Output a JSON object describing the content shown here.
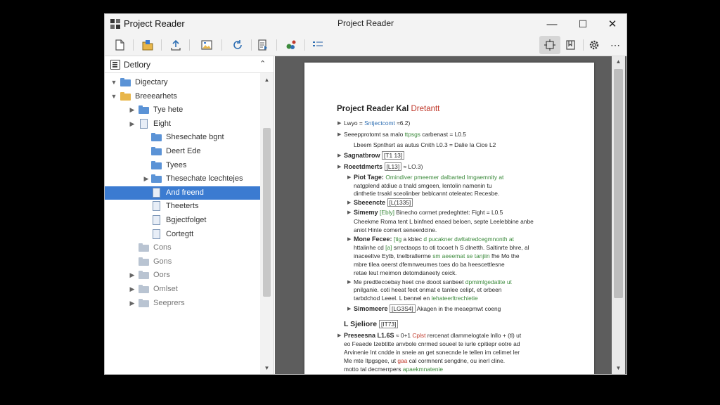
{
  "window": {
    "app_name": "Project Reader",
    "title": "Project Reader",
    "controls": {
      "minimize": "—",
      "maximize": "☐",
      "close": "✕"
    }
  },
  "toolbar": {
    "buttons": [
      {
        "icon": "new-page-icon"
      },
      {
        "icon": "open-folder-icon"
      },
      {
        "icon": "upload-icon"
      },
      {
        "icon": "image-icon"
      },
      {
        "icon": "refresh-icon"
      },
      {
        "icon": "export-icon"
      },
      {
        "icon": "color-palette-icon"
      },
      {
        "icon": "list-view-icon"
      }
    ],
    "right_buttons": [
      {
        "icon": "fit-page-icon",
        "active": true
      },
      {
        "icon": "bookmark-icon"
      },
      {
        "icon": "settings-gear-icon"
      },
      {
        "icon": "more-options-icon",
        "label": "⋯"
      }
    ]
  },
  "sidebar": {
    "header": {
      "label": "Detlory",
      "chevron": "⌃"
    },
    "tree": [
      {
        "label": "Digectary",
        "twisty": "▼",
        "icon": "folder-blue",
        "level": 0
      },
      {
        "label": "Breeearhets",
        "twisty": "▼",
        "icon": "folder-yellow",
        "level": 0
      },
      {
        "label": "Tye hete",
        "twisty": "▶",
        "icon": "folder-blue",
        "level": 1
      },
      {
        "label": "Eight",
        "twisty": "▶",
        "icon": "doc",
        "level": 1
      },
      {
        "label": "Shesechate bgnt",
        "twisty": "",
        "icon": "folder-blue",
        "level": 2
      },
      {
        "label": "Deert Ede",
        "twisty": "",
        "icon": "folder-blue",
        "level": 2
      },
      {
        "label": "Tyees",
        "twisty": "",
        "icon": "folder-blue",
        "level": 2
      },
      {
        "label": "Thesechate lcechtejes",
        "twisty": "▶",
        "icon": "folder-blue",
        "level": 2
      },
      {
        "label": "And freend",
        "twisty": "",
        "icon": "doc",
        "level": 2,
        "selected": true
      },
      {
        "label": "Theeterts",
        "twisty": "",
        "icon": "doc",
        "level": 2
      },
      {
        "label": "Bgjectfolget",
        "twisty": "",
        "icon": "doc",
        "level": 2
      },
      {
        "label": "Cortegtt",
        "twisty": "",
        "icon": "doc",
        "level": 2
      },
      {
        "label": "Cons",
        "twisty": "",
        "icon": "folder-grey",
        "level": 1,
        "muted": true
      },
      {
        "label": "Gons",
        "twisty": "",
        "icon": "folder-grey",
        "level": 1,
        "muted": true
      },
      {
        "label": "Oors",
        "twisty": "▶",
        "icon": "folder-grey",
        "level": 1,
        "muted": true
      },
      {
        "label": "Omlset",
        "twisty": "▶",
        "icon": "folder-grey",
        "level": 1,
        "muted": true
      },
      {
        "label": "Seeprers",
        "twisty": "▶",
        "icon": "folder-grey",
        "level": 1,
        "muted": true
      }
    ],
    "scroll_position": 0.0
  },
  "document": {
    "title": "Project Reader Kal",
    "title_accent": "Dretantt",
    "lines": [
      {
        "indent": 0,
        "bullet": "▶",
        "parts": [
          {
            "t": "Lwyo = "
          },
          {
            "t": "Sntjectcomt",
            "c": "b"
          },
          {
            "t": " ≈6.2)"
          }
        ]
      },
      {
        "indent": 0,
        "bullet": "▶",
        "parts": [
          {
            "t": "Seeepprotomt sa malo "
          },
          {
            "t": "ttpsgs",
            "c": "g"
          },
          {
            "t": " carbenast = L0.5"
          }
        ]
      },
      {
        "indent": 1,
        "bullet": "",
        "parts": [
          {
            "t": "Lbeem Spnthsrt as autus Cnith L0.3 = Dalie Ia Cice L2"
          }
        ]
      },
      {
        "indent": 0,
        "bullet": "▶",
        "parts": [
          {
            "t": "Sagnatbrow ",
            "s": true
          },
          {
            "t": "[T1 13]",
            "c": "box"
          }
        ]
      },
      {
        "indent": 0,
        "bullet": "▶",
        "parts": [
          {
            "t": "Roeetdmerts ",
            "s": true
          },
          {
            "t": "[L13]",
            "c": "box"
          },
          {
            "t": "  ≈ LO.3)"
          }
        ]
      },
      {
        "indent": 1,
        "bullet": "▶",
        "parts": [
          {
            "t": "Piot Tage: ",
            "s": true
          },
          {
            "t": "Omindiver pmeemer dalbarted Imgaemnity at",
            "c": "g"
          }
        ]
      },
      {
        "indent": 1,
        "bullet": "",
        "parts": [
          {
            "t": "natgplend atdiue a tnald smgeen, lentolin namenin tu"
          }
        ]
      },
      {
        "indent": 1,
        "bullet": "",
        "parts": [
          {
            "t": "dinthetie trsakl sceolinber beblcannt oteleatec Recesbe."
          }
        ]
      },
      {
        "indent": 1,
        "bullet": "▶",
        "parts": [
          {
            "t": "Sbeeencte ",
            "s": true
          },
          {
            "t": "[L(1335]",
            "c": "box"
          }
        ]
      },
      {
        "indent": 1,
        "bullet": "▶",
        "parts": [
          {
            "t": "Simemy ",
            "s": true
          },
          {
            "t": "[Ebly]",
            "c": "g"
          },
          {
            "t": " Binecho cormet predeghttet: Fight = L0.5"
          }
        ]
      },
      {
        "indent": 1,
        "bullet": "",
        "parts": [
          {
            "t": "Cheekme Roma tent L binfned enaed beloen, septe Leelebbine anbe"
          }
        ]
      },
      {
        "indent": 1,
        "bullet": "",
        "parts": [
          {
            "t": "aniot Hinte comert seneerdcine."
          }
        ]
      },
      {
        "indent": 1,
        "bullet": "▶",
        "parts": [
          {
            "t": "Mone Fecee: ",
            "s": true
          },
          {
            "t": "[tig",
            "c": "g"
          },
          {
            "t": " a kblec "
          },
          {
            "t": "d pucakner dwltatredcegmnonth at",
            "c": "g"
          }
        ]
      },
      {
        "indent": 1,
        "bullet": "",
        "parts": [
          {
            "t": "httalinhe cd "
          },
          {
            "t": "[a]",
            "c": "g"
          },
          {
            "t": " srrectaops to oti tocoet h S dlnetth. Saltinrte bhre, al"
          }
        ]
      },
      {
        "indent": 1,
        "bullet": "",
        "parts": [
          {
            "t": "inaceeltve Eytb, tnelbrallerme "
          },
          {
            "t": "sm aeeemat se tanjiin",
            "c": "g"
          },
          {
            "t": " fhe Mo the"
          }
        ]
      },
      {
        "indent": 1,
        "bullet": "",
        "parts": [
          {
            "t": "mbre tilea oeerst dfemnweumes toes do ba heescettlesne"
          }
        ]
      },
      {
        "indent": 1,
        "bullet": "",
        "parts": [
          {
            "t": "retae leut rneimon detomdaneety ceick."
          }
        ]
      },
      {
        "indent": 1,
        "bullet": "▶",
        "parts": [
          {
            "t": "Me predtlecoebay heet cne dooot sanbeet "
          },
          {
            "t": "dpmimlgedatite ut",
            "c": "g"
          }
        ]
      },
      {
        "indent": 1,
        "bullet": "",
        "parts": [
          {
            "t": "pnilganie. coti heeat feet onmat e tanlee celipt, et orbeen"
          }
        ]
      },
      {
        "indent": 1,
        "bullet": "",
        "parts": [
          {
            "t": "tarbdchod Leeel. L bennel en "
          },
          {
            "t": "lehateerltrechietie",
            "c": "g"
          }
        ]
      },
      {
        "indent": 1,
        "bullet": "▶",
        "parts": [
          {
            "t": "Simomeere ",
            "s": true
          },
          {
            "t": "[LG3S4]",
            "c": "box"
          },
          {
            "t": " Akagen in the meaepmwt coeng"
          }
        ]
      },
      {
        "indent": 0,
        "bullet": "",
        "parts": [
          {
            "t": "L Sjeliore ",
            "s": true,
            "big": true
          },
          {
            "t": "[IT73]",
            "c": "box"
          }
        ]
      },
      {
        "indent": 0,
        "bullet": "▶",
        "parts": [
          {
            "t": "Preseesna L1.6S",
            "s": true
          },
          {
            "t": " ≈ 0+1 "
          },
          {
            "t": "Cplst",
            "c": "r"
          },
          {
            "t": " rercenat dlammelogtale lnllo + (tl) ut"
          }
        ]
      },
      {
        "indent": 0,
        "bullet": "",
        "parts": [
          {
            "t": "eo Feaede Izebtitte anvbole cnrmed soueel te iurle cpitiepr eotre ad"
          }
        ]
      },
      {
        "indent": 0,
        "bullet": "",
        "parts": [
          {
            "t": "Arvinenie Int cndde in sneie an get sonecnde le tellen im celimet ler"
          }
        ]
      },
      {
        "indent": 0,
        "bullet": "",
        "parts": [
          {
            "t": "Me mte Itpgsgee, ut "
          },
          {
            "t": "gaa",
            "c": "r"
          },
          {
            "t": " cal cormnent sengdne, ou inerl cline."
          }
        ]
      },
      {
        "indent": 0,
        "bullet": "",
        "parts": [
          {
            "t": "motto tal decmerrpers "
          },
          {
            "t": "apaekmnatenie",
            "c": "g"
          }
        ]
      }
    ]
  },
  "viewer_scroll_position": 0.1
}
